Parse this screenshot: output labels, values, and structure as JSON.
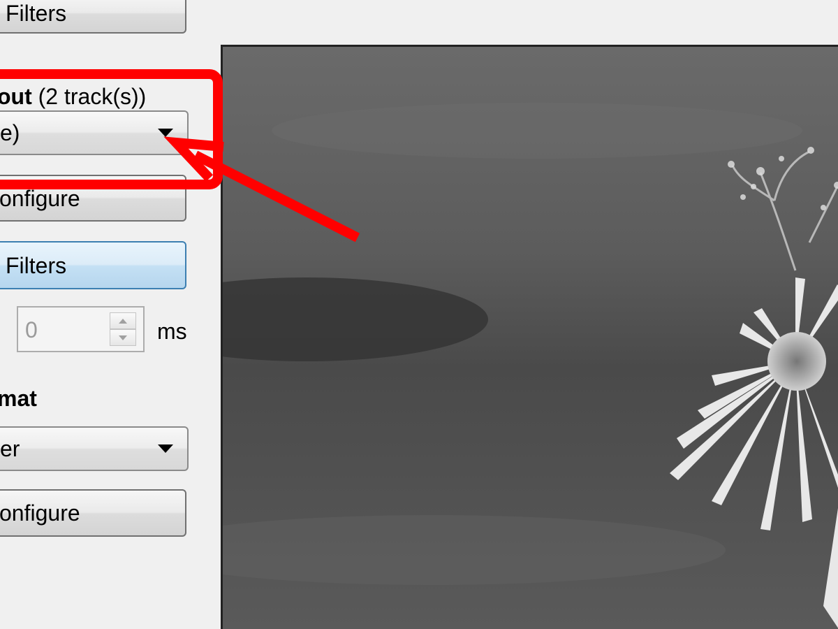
{
  "video_filters_button": "Filters",
  "audio_output": {
    "label_bold": "out",
    "label_rest": " (2 track(s))",
    "codec_value": "e)",
    "configure_label": "onfigure",
    "filters_label": "Filters"
  },
  "shift": {
    "value": "0",
    "unit": "ms"
  },
  "output_format": {
    "label": "mat",
    "value": "er",
    "configure_label": "onfigure"
  },
  "preview": {
    "icon": "flower-preview-image"
  },
  "annotation": {
    "color": "#ff0000"
  }
}
